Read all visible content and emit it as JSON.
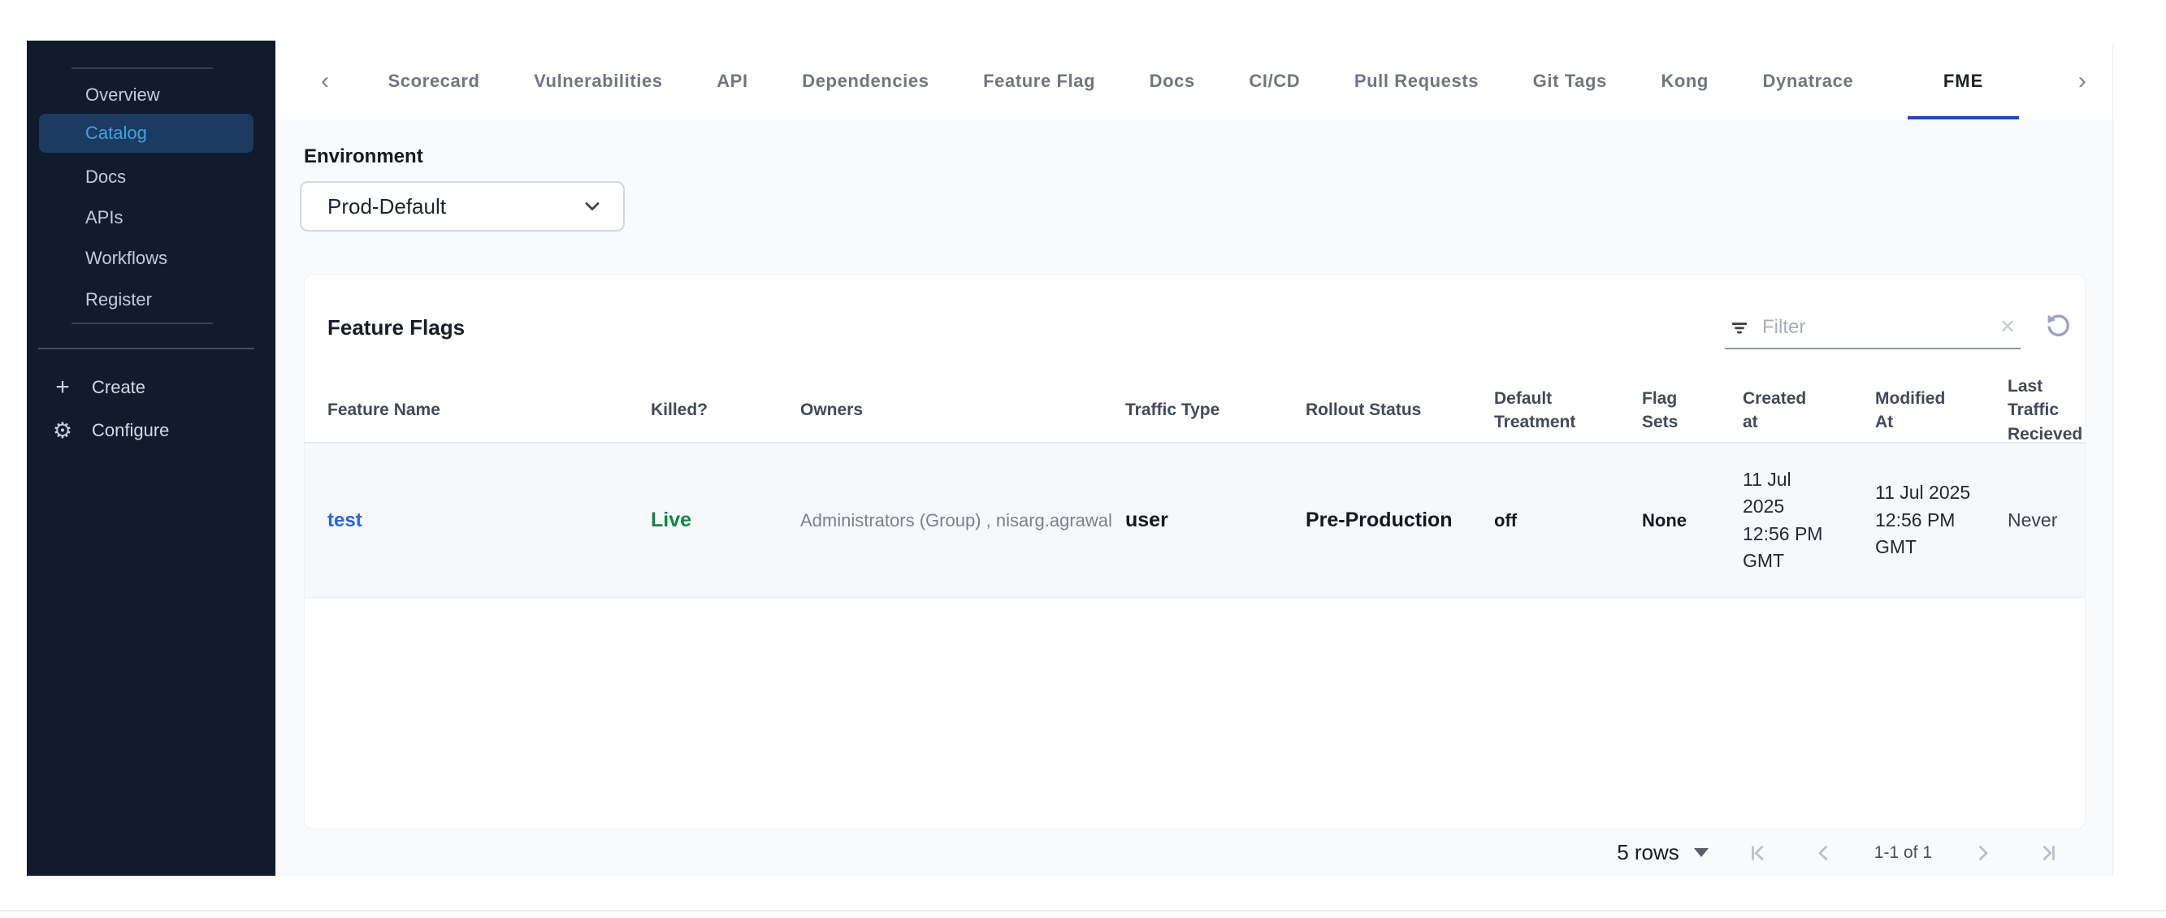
{
  "sidebar": {
    "items": [
      {
        "label": "Overview",
        "active": false
      },
      {
        "label": "Catalog",
        "active": true
      },
      {
        "label": "Docs",
        "active": false
      },
      {
        "label": "APIs",
        "active": false
      },
      {
        "label": "Workflows",
        "active": false
      },
      {
        "label": "Register",
        "active": false
      }
    ],
    "create_label": "Create",
    "configure_label": "Configure"
  },
  "tabs": {
    "items": [
      {
        "label": "Scorecard"
      },
      {
        "label": "Vulnerabilities"
      },
      {
        "label": "API"
      },
      {
        "label": "Dependencies"
      },
      {
        "label": "Feature Flag"
      },
      {
        "label": "Docs"
      },
      {
        "label": "CI/CD"
      },
      {
        "label": "Pull Requests"
      },
      {
        "label": "Git Tags"
      },
      {
        "label": "Kong"
      },
      {
        "label": "Dynatrace"
      },
      {
        "label": "FME"
      }
    ],
    "active": "FME"
  },
  "environment": {
    "label": "Environment",
    "selected": "Prod-Default"
  },
  "panel": {
    "title": "Feature Flags",
    "filter_placeholder": "Filter",
    "columns": [
      "Feature Name",
      "Killed?",
      "Owners",
      "Traffic Type",
      "Rollout Status",
      "Default Treatment",
      "Flag Sets",
      "Created at",
      "Modified At",
      "Last Traffic Recieved"
    ],
    "rows": [
      {
        "feature_name": "test",
        "killed": "Live",
        "owners": "Administrators (Group) , nisarg.agrawal",
        "traffic_type": "user",
        "rollout_status": "Pre-Production",
        "default_treatment": "off",
        "flag_sets": "None",
        "created_at": "11 Jul 2025 12:56 PM GMT",
        "modified_at": "11 Jul 2025 12:56 PM GMT",
        "last_traffic_recieved": "Never"
      }
    ]
  },
  "pagination": {
    "rows_per_page": "5 rows",
    "range_label": "1-1 of 1"
  },
  "icons": {
    "tabs_scroll_left": "chevron-left",
    "tabs_scroll_right": "chevron-right",
    "environment_dropdown": "chevron-down",
    "filter": "filter-lines",
    "clear_filter": "x",
    "reset": "rotate-left",
    "create": "plus",
    "configure": "gear",
    "rows_per_page": "caret-down",
    "first_page": "chevron-bar-left",
    "prev_page": "chevron-left",
    "next_page": "chevron-right",
    "last_page": "chevron-bar-right"
  },
  "colors": {
    "sidebar_bg": "#101b2c",
    "sidebar_selected_bg": "#1c3b60",
    "sidebar_selected_text": "#3ea4e2",
    "active_tab_underline": "#1a46cc",
    "link_blue": "#2563eb",
    "live_green": "#0c8a3e",
    "content_bg": "#f8fafc"
  }
}
